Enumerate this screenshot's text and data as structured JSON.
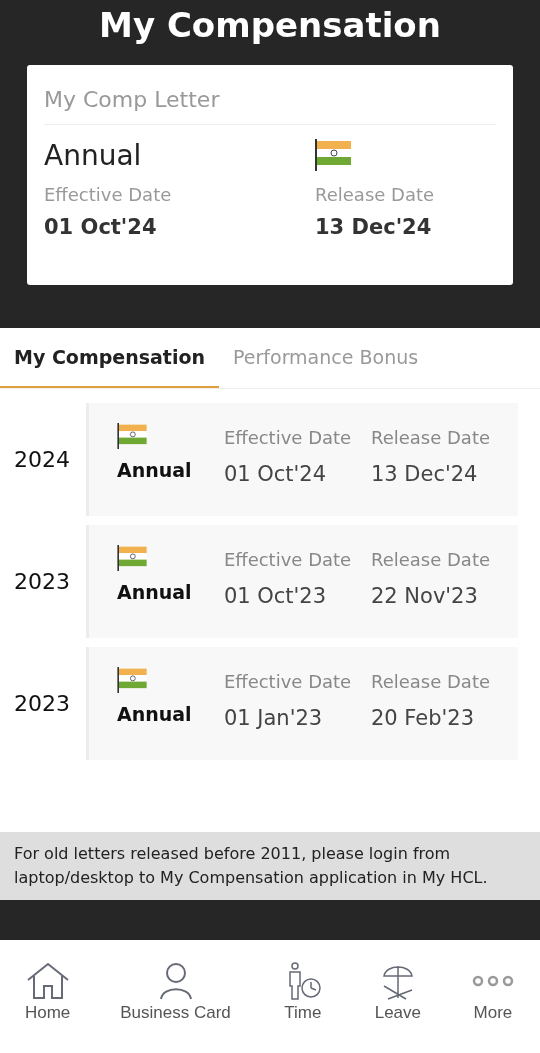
{
  "header": {
    "title": "My Compensation"
  },
  "letter_card": {
    "title": "My Comp Letter",
    "type": "Annual",
    "effective_label": "Effective Date",
    "effective_date": "01 Oct'24",
    "release_label": "Release Date",
    "release_date": "13 Dec'24"
  },
  "tabs": [
    {
      "label": "My Compensation",
      "selected": true
    },
    {
      "label": "Performance Bonus",
      "selected": false
    }
  ],
  "letters": [
    {
      "year": "2024",
      "type": "Annual",
      "effective_label": "Effective Date",
      "effective_date": "01 Oct'24",
      "release_label": "Release Date",
      "release_date": "13 Dec'24"
    },
    {
      "year": "2023",
      "type": "Annual",
      "effective_label": "Effective Date",
      "effective_date": "01 Oct'23",
      "release_label": "Release Date",
      "release_date": "22 Nov'23"
    },
    {
      "year": "2023",
      "type": "Annual",
      "effective_label": "Effective Date",
      "effective_date": "01 Jan'23",
      "release_label": "Release Date",
      "release_date": "20 Feb'23"
    }
  ],
  "notice": "For old letters released before 2011, please login from laptop/desktop to My Compensation application in My HCL.",
  "nav": [
    {
      "label": "Home",
      "kind": "home"
    },
    {
      "label": "Business Card",
      "kind": "person"
    },
    {
      "label": "Time",
      "kind": "time"
    },
    {
      "label": "Leave",
      "kind": "leave"
    },
    {
      "label": "More",
      "kind": "more"
    }
  ]
}
